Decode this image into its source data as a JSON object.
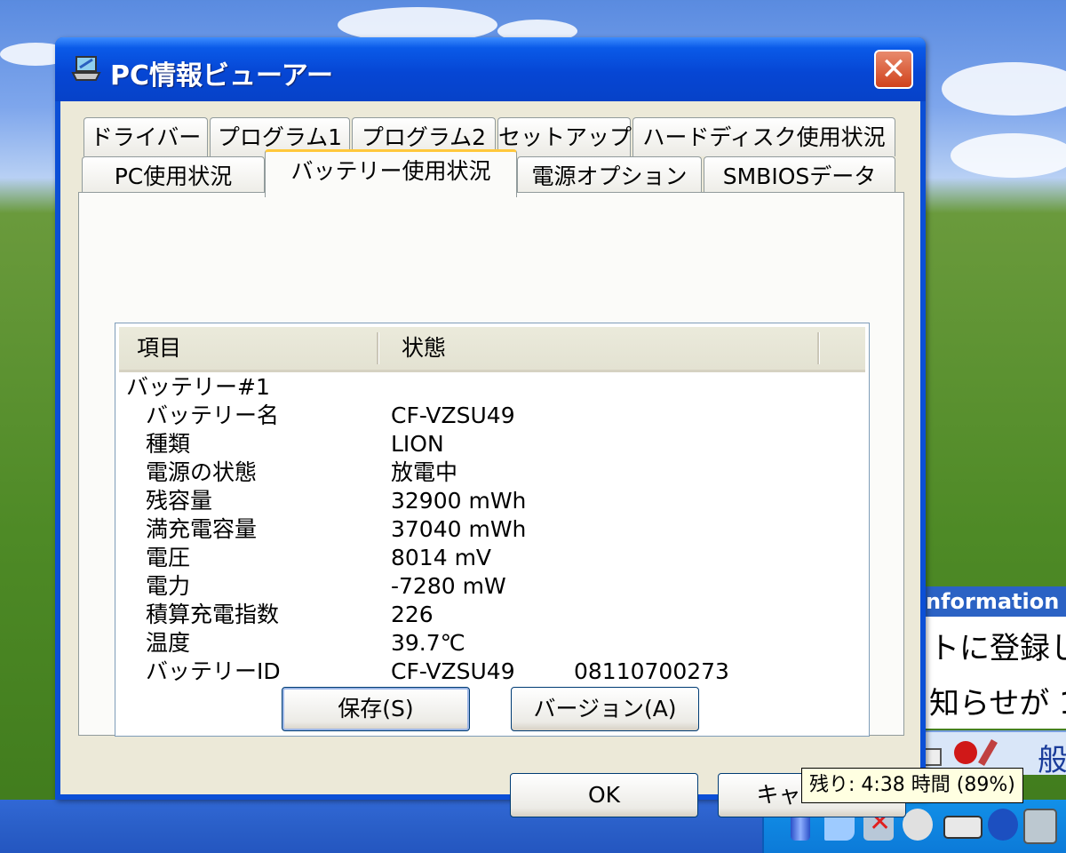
{
  "window": {
    "title": "PC情報ビューアー",
    "close_glyph": "✕"
  },
  "tabs": {
    "row1": [
      "ドライバー",
      "プログラム1",
      "プログラム2",
      "セットアップ",
      "ハードディスク使用状況"
    ],
    "row2": [
      "PC使用状況",
      "バッテリー使用状況",
      "電源オプション",
      "SMBIOSデータ"
    ],
    "active": "バッテリー使用状況"
  },
  "list": {
    "columns": [
      "項目",
      "状態"
    ],
    "group": "バッテリー#1",
    "rows": [
      {
        "label": "バッテリー名",
        "value": "CF-VZSU49",
        "extra": ""
      },
      {
        "label": "種類",
        "value": "LION",
        "extra": ""
      },
      {
        "label": "電源の状態",
        "value": "放電中",
        "extra": ""
      },
      {
        "label": "残容量",
        "value": "32900 mWh",
        "extra": ""
      },
      {
        "label": "満充電容量",
        "value": "37040 mWh",
        "extra": ""
      },
      {
        "label": "電圧",
        "value": "8014 mV",
        "extra": ""
      },
      {
        "label": "電力",
        "value": "-7280 mW",
        "extra": ""
      },
      {
        "label": "積算充電指数",
        "value": "226",
        "extra": ""
      },
      {
        "label": "温度",
        "value": "39.7℃",
        "extra": ""
      },
      {
        "label": "バッテリーID",
        "value": "CF-VZSU49",
        "extra": "08110700273"
      }
    ]
  },
  "buttons": {
    "save": "保存(S)",
    "version": "バージョン(A)",
    "ok": "OK",
    "cancel": "キャンセル"
  },
  "background_window": {
    "title": "nformation",
    "line1": "トに登録し",
    "line2": "知らせが 1"
  },
  "toolbar_text": "般",
  "tooltip": "残り: 4:38 時間 (89%)",
  "tray_icons": [
    "battery-icon",
    "chat-icon",
    "network-icon",
    "security-icon",
    "device-icon",
    "bluetooth-icon",
    "computer-icon"
  ],
  "colors": {
    "titlebar": "#0a5ae8",
    "dialog_bg": "#ece9d8",
    "active_tab_accent": "#ffc83c",
    "close_button": "#d0421c"
  }
}
